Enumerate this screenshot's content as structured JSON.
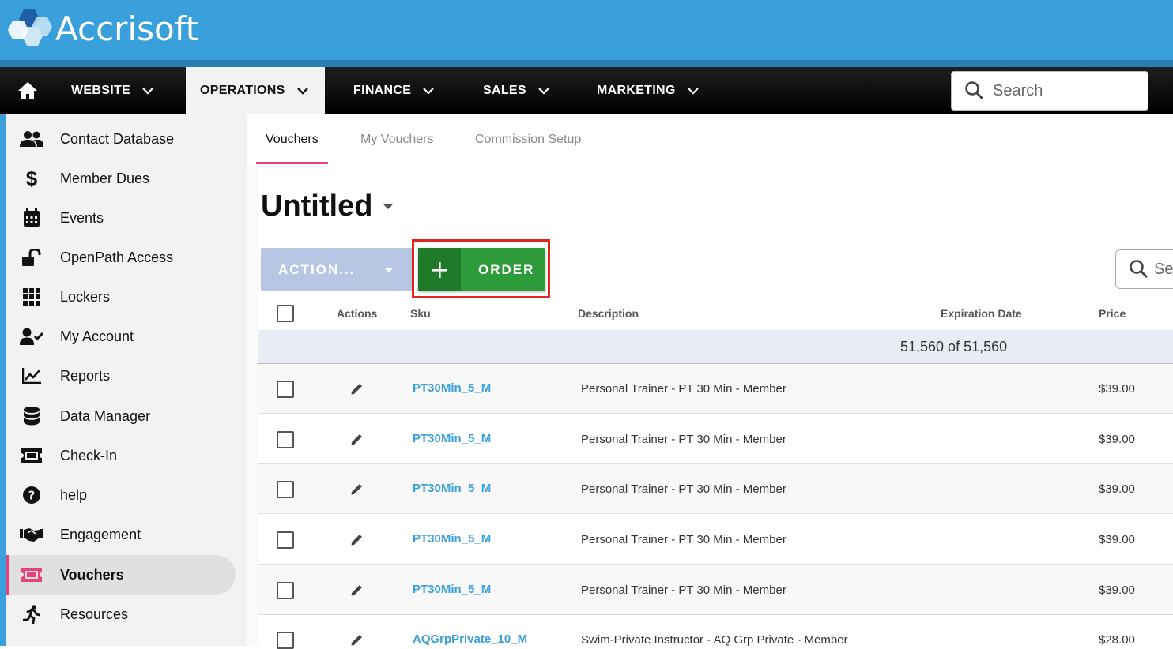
{
  "brand": {
    "name": "Accrisoft"
  },
  "nav": {
    "items": [
      {
        "label": "WEBSITE"
      },
      {
        "label": "OPERATIONS"
      },
      {
        "label": "FINANCE"
      },
      {
        "label": "SALES"
      },
      {
        "label": "MARKETING"
      }
    ],
    "active": "OPERATIONS",
    "search_placeholder": "Search"
  },
  "sidebar": {
    "items": [
      {
        "label": "Contact Database",
        "icon": "users-icon"
      },
      {
        "label": "Member Dues",
        "icon": "dollar-icon"
      },
      {
        "label": "Events",
        "icon": "calendar-icon"
      },
      {
        "label": "OpenPath Access",
        "icon": "unlock-icon"
      },
      {
        "label": "Lockers",
        "icon": "grid-icon"
      },
      {
        "label": "My Account",
        "icon": "user-check-icon"
      },
      {
        "label": "Reports",
        "icon": "chart-icon"
      },
      {
        "label": "Data Manager",
        "icon": "database-icon"
      },
      {
        "label": "Check-In",
        "icon": "ticket-icon"
      },
      {
        "label": "help",
        "icon": "help-icon"
      },
      {
        "label": "Engagement",
        "icon": "handshake-icon"
      },
      {
        "label": "Vouchers",
        "icon": "voucher-icon"
      },
      {
        "label": "Resources",
        "icon": "runner-icon"
      }
    ],
    "active": "Vouchers"
  },
  "tabs": [
    {
      "label": "Vouchers"
    },
    {
      "label": "My Vouchers"
    },
    {
      "label": "Commission Setup"
    }
  ],
  "page": {
    "title": "Untitled",
    "action_label": "ACTION...",
    "order_label": "ORDER",
    "grid_search_placeholder": "Se"
  },
  "table": {
    "headers": {
      "actions": "Actions",
      "sku": "Sku",
      "description": "Description",
      "expiration": "Expiration Date",
      "price": "Price"
    },
    "count_text": "51,560 of 51,560",
    "rows": [
      {
        "sku": "PT30Min_5_M",
        "description": "Personal Trainer - PT 30 Min - Member",
        "price": "$39.00"
      },
      {
        "sku": "PT30Min_5_M",
        "description": "Personal Trainer - PT 30 Min - Member",
        "price": "$39.00"
      },
      {
        "sku": "PT30Min_5_M",
        "description": "Personal Trainer - PT 30 Min - Member",
        "price": "$39.00"
      },
      {
        "sku": "PT30Min_5_M",
        "description": "Personal Trainer - PT 30 Min - Member",
        "price": "$39.00"
      },
      {
        "sku": "PT30Min_5_M",
        "description": "Personal Trainer - PT 30 Min - Member",
        "price": "$39.00"
      },
      {
        "sku": "AQGrpPrivate_10_M",
        "description": "Swim-Private Instructor - AQ Grp Private - Member",
        "price": "$28.00"
      }
    ]
  },
  "colors": {
    "header_blue": "#3aa0dc",
    "accent_pink": "#e8417d",
    "order_green": "#2e9b3a",
    "highlight_red": "#e8231b"
  }
}
